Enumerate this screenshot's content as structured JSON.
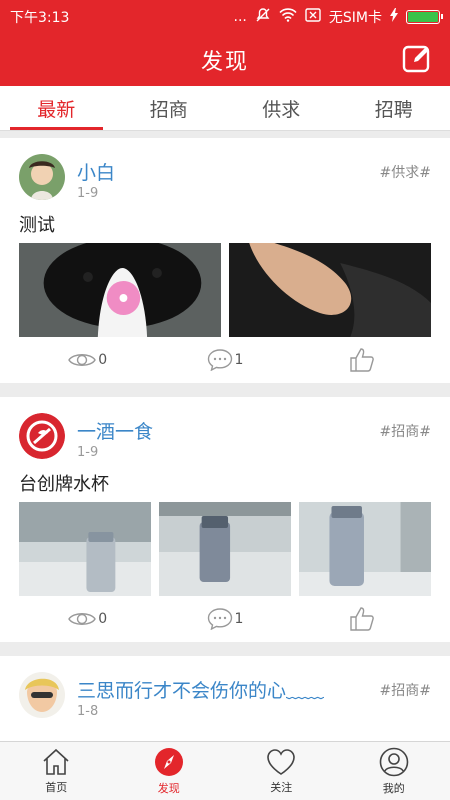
{
  "status": {
    "time": "下午3:13",
    "dots": "...",
    "sim": "无SIM卡"
  },
  "colors": {
    "brand": "#e3262b",
    "link": "#3b86c8"
  },
  "header": {
    "title": "发现",
    "edit_icon": "edit-icon"
  },
  "tabs": [
    {
      "label": "最新",
      "active": true
    },
    {
      "label": "招商",
      "active": false
    },
    {
      "label": "供求",
      "active": false
    },
    {
      "label": "招聘",
      "active": false
    }
  ],
  "posts": [
    {
      "user": "小白",
      "date": "1-9",
      "tag": "#供求#",
      "text": "测试",
      "views": "0",
      "comments": "1"
    },
    {
      "user": "一酒一食",
      "date": "1-9",
      "tag": "#招商#",
      "text": "台创牌水杯",
      "views": "0",
      "comments": "1"
    },
    {
      "user": "三思而行才不会伤你的心﹏﹏",
      "date": "1-8",
      "tag": "#招商#",
      "text": ""
    }
  ],
  "bottom_nav": [
    {
      "label": "首页",
      "icon": "home-icon",
      "active": false
    },
    {
      "label": "发现",
      "icon": "compass-icon",
      "active": true
    },
    {
      "label": "关注",
      "icon": "heart-icon",
      "active": false
    },
    {
      "label": "我的",
      "icon": "user-icon",
      "active": false
    }
  ]
}
